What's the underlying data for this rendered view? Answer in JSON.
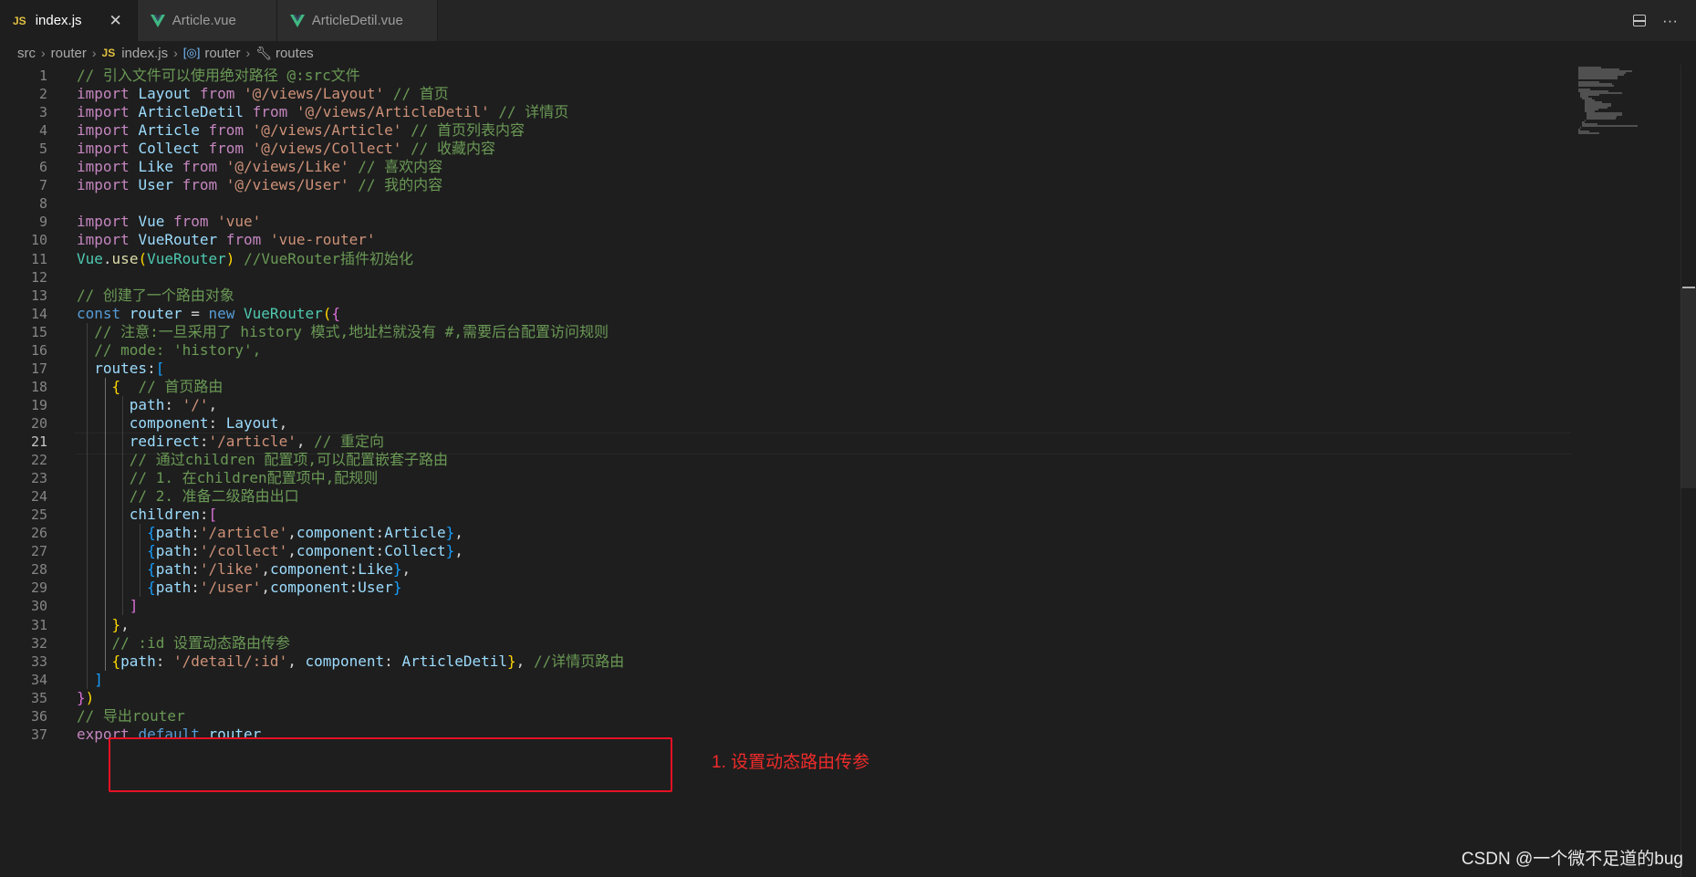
{
  "tabs": [
    {
      "label": "index.js",
      "badge": "JS",
      "close": "✕"
    },
    {
      "label": "Article.vue"
    },
    {
      "label": "ArticleDetil.vue"
    }
  ],
  "tab_actions": {
    "more": "···"
  },
  "breadcrumb": {
    "items": [
      "src",
      "router",
      "index.js",
      "router",
      "routes"
    ],
    "badge": "JS"
  },
  "code_lines": [
    [
      {
        "t": "// 引入文件可以使用绝对路径 @:src文件",
        "c": "c"
      }
    ],
    [
      {
        "t": "import ",
        "c": "k"
      },
      {
        "t": "Layout ",
        "c": "v"
      },
      {
        "t": "from ",
        "c": "k"
      },
      {
        "t": "'@/views/Layout'",
        "c": "s"
      },
      {
        "t": " // 首页",
        "c": "c"
      }
    ],
    [
      {
        "t": "import ",
        "c": "k"
      },
      {
        "t": "ArticleDetil ",
        "c": "v"
      },
      {
        "t": "from ",
        "c": "k"
      },
      {
        "t": "'@/views/ArticleDetil'",
        "c": "s"
      },
      {
        "t": " // 详情页",
        "c": "c"
      }
    ],
    [
      {
        "t": "import ",
        "c": "k"
      },
      {
        "t": "Article ",
        "c": "v"
      },
      {
        "t": "from ",
        "c": "k"
      },
      {
        "t": "'@/views/Article'",
        "c": "s"
      },
      {
        "t": " // 首页列表内容",
        "c": "c"
      }
    ],
    [
      {
        "t": "import ",
        "c": "k"
      },
      {
        "t": "Collect ",
        "c": "v"
      },
      {
        "t": "from ",
        "c": "k"
      },
      {
        "t": "'@/views/Collect'",
        "c": "s"
      },
      {
        "t": " // 收藏内容",
        "c": "c"
      }
    ],
    [
      {
        "t": "import ",
        "c": "k"
      },
      {
        "t": "Like ",
        "c": "v"
      },
      {
        "t": "from ",
        "c": "k"
      },
      {
        "t": "'@/views/Like'",
        "c": "s"
      },
      {
        "t": " // 喜欢内容",
        "c": "c"
      }
    ],
    [
      {
        "t": "import ",
        "c": "k"
      },
      {
        "t": "User ",
        "c": "v"
      },
      {
        "t": "from ",
        "c": "k"
      },
      {
        "t": "'@/views/User'",
        "c": "s"
      },
      {
        "t": " // 我的内容",
        "c": "c"
      }
    ],
    [],
    [
      {
        "t": "import ",
        "c": "k"
      },
      {
        "t": "Vue ",
        "c": "v"
      },
      {
        "t": "from ",
        "c": "k"
      },
      {
        "t": "'vue'",
        "c": "s"
      }
    ],
    [
      {
        "t": "import ",
        "c": "k"
      },
      {
        "t": "VueRouter ",
        "c": "v"
      },
      {
        "t": "from ",
        "c": "k"
      },
      {
        "t": "'vue-router'",
        "c": "s"
      }
    ],
    [
      {
        "t": "Vue",
        "c": "cls"
      },
      {
        "t": ".",
        "c": "p"
      },
      {
        "t": "use",
        "c": "f"
      },
      {
        "t": "(",
        "c": "br1"
      },
      {
        "t": "VueRouter",
        "c": "cls"
      },
      {
        "t": ")",
        "c": "br1"
      },
      {
        "t": " //VueRouter插件初始化",
        "c": "c"
      }
    ],
    [],
    [
      {
        "t": "// 创建了一个路由对象",
        "c": "c"
      }
    ],
    [
      {
        "t": "const ",
        "c": "b"
      },
      {
        "t": "router",
        "c": "v"
      },
      {
        "t": " = ",
        "c": "p"
      },
      {
        "t": "new ",
        "c": "b"
      },
      {
        "t": "VueRouter",
        "c": "cls"
      },
      {
        "t": "(",
        "c": "br1"
      },
      {
        "t": "{",
        "c": "br2"
      }
    ],
    [
      {
        "t": "  // 注意:一旦采用了 history 模式,地址栏就没有 #,需要后台配置访问规则",
        "c": "c"
      }
    ],
    [
      {
        "t": "  // mode: 'history',",
        "c": "c"
      }
    ],
    [
      {
        "t": "  routes",
        "c": "v"
      },
      {
        "t": ":",
        "c": "p"
      },
      {
        "t": "[",
        "c": "br3"
      }
    ],
    [
      {
        "t": "    {",
        "c": "br1"
      },
      {
        "t": "  // 首页路由",
        "c": "c"
      }
    ],
    [
      {
        "t": "      path",
        "c": "v"
      },
      {
        "t": ": ",
        "c": "p"
      },
      {
        "t": "'/'",
        "c": "s"
      },
      {
        "t": ",",
        "c": "p"
      }
    ],
    [
      {
        "t": "      component",
        "c": "v"
      },
      {
        "t": ": ",
        "c": "p"
      },
      {
        "t": "Layout",
        "c": "v"
      },
      {
        "t": ",",
        "c": "p"
      }
    ],
    [
      {
        "t": "      redirect",
        "c": "v"
      },
      {
        "t": ":",
        "c": "p"
      },
      {
        "t": "'/article'",
        "c": "s"
      },
      {
        "t": ", ",
        "c": "p"
      },
      {
        "t": "// 重定向",
        "c": "c"
      }
    ],
    [
      {
        "t": "      // 通过children 配置项,可以配置嵌套子路由",
        "c": "c"
      }
    ],
    [
      {
        "t": "      // 1. 在children配置项中,配规则",
        "c": "c"
      }
    ],
    [
      {
        "t": "      // 2. 准备二级路由出口",
        "c": "c"
      }
    ],
    [
      {
        "t": "      children",
        "c": "v"
      },
      {
        "t": ":",
        "c": "p"
      },
      {
        "t": "[",
        "c": "br2"
      }
    ],
    [
      {
        "t": "        {",
        "c": "br3"
      },
      {
        "t": "path",
        "c": "v"
      },
      {
        "t": ":",
        "c": "p"
      },
      {
        "t": "'/article'",
        "c": "s"
      },
      {
        "t": ",",
        "c": "p"
      },
      {
        "t": "component",
        "c": "v"
      },
      {
        "t": ":",
        "c": "p"
      },
      {
        "t": "Article",
        "c": "v"
      },
      {
        "t": "}",
        "c": "br3"
      },
      {
        "t": ",",
        "c": "p"
      }
    ],
    [
      {
        "t": "        {",
        "c": "br3"
      },
      {
        "t": "path",
        "c": "v"
      },
      {
        "t": ":",
        "c": "p"
      },
      {
        "t": "'/collect'",
        "c": "s"
      },
      {
        "t": ",",
        "c": "p"
      },
      {
        "t": "component",
        "c": "v"
      },
      {
        "t": ":",
        "c": "p"
      },
      {
        "t": "Collect",
        "c": "v"
      },
      {
        "t": "}",
        "c": "br3"
      },
      {
        "t": ",",
        "c": "p"
      }
    ],
    [
      {
        "t": "        {",
        "c": "br3"
      },
      {
        "t": "path",
        "c": "v"
      },
      {
        "t": ":",
        "c": "p"
      },
      {
        "t": "'/like'",
        "c": "s"
      },
      {
        "t": ",",
        "c": "p"
      },
      {
        "t": "component",
        "c": "v"
      },
      {
        "t": ":",
        "c": "p"
      },
      {
        "t": "Like",
        "c": "v"
      },
      {
        "t": "}",
        "c": "br3"
      },
      {
        "t": ",",
        "c": "p"
      }
    ],
    [
      {
        "t": "        {",
        "c": "br3"
      },
      {
        "t": "path",
        "c": "v"
      },
      {
        "t": ":",
        "c": "p"
      },
      {
        "t": "'/user'",
        "c": "s"
      },
      {
        "t": ",",
        "c": "p"
      },
      {
        "t": "component",
        "c": "v"
      },
      {
        "t": ":",
        "c": "p"
      },
      {
        "t": "User",
        "c": "v"
      },
      {
        "t": "}",
        "c": "br3"
      }
    ],
    [
      {
        "t": "      ]",
        "c": "br2"
      }
    ],
    [
      {
        "t": "    }",
        "c": "br1"
      },
      {
        "t": ",",
        "c": "p"
      }
    ],
    [
      {
        "t": "    // :id 设置动态路由传参",
        "c": "c"
      }
    ],
    [
      {
        "t": "    {",
        "c": "br1"
      },
      {
        "t": "path",
        "c": "v"
      },
      {
        "t": ": ",
        "c": "p"
      },
      {
        "t": "'/detail/:id'",
        "c": "s"
      },
      {
        "t": ", ",
        "c": "p"
      },
      {
        "t": "component",
        "c": "v"
      },
      {
        "t": ": ",
        "c": "p"
      },
      {
        "t": "ArticleDetil",
        "c": "v"
      },
      {
        "t": "}",
        "c": "br1"
      },
      {
        "t": ", ",
        "c": "p"
      },
      {
        "t": "//详情页路由",
        "c": "c"
      }
    ],
    [
      {
        "t": "  ]",
        "c": "br3"
      }
    ],
    [
      {
        "t": "}",
        "c": "br2"
      },
      {
        "t": ")",
        "c": "br1"
      }
    ],
    [
      {
        "t": "// 导出router",
        "c": "c"
      }
    ],
    [
      {
        "t": "export ",
        "c": "k"
      },
      {
        "t": "default ",
        "c": "b"
      },
      {
        "t": "router",
        "c": "v"
      }
    ]
  ],
  "current_line": 21,
  "annotation": "1. 设置动态路由传参",
  "watermark": "CSDN @一个微不足道的bug",
  "colors": {
    "keyword": "#c586c0",
    "string": "#ce9178",
    "comment": "#6a9955",
    "variable": "#9cdcfe",
    "class": "#4ec9b0",
    "highlight_box": "#e81123"
  }
}
